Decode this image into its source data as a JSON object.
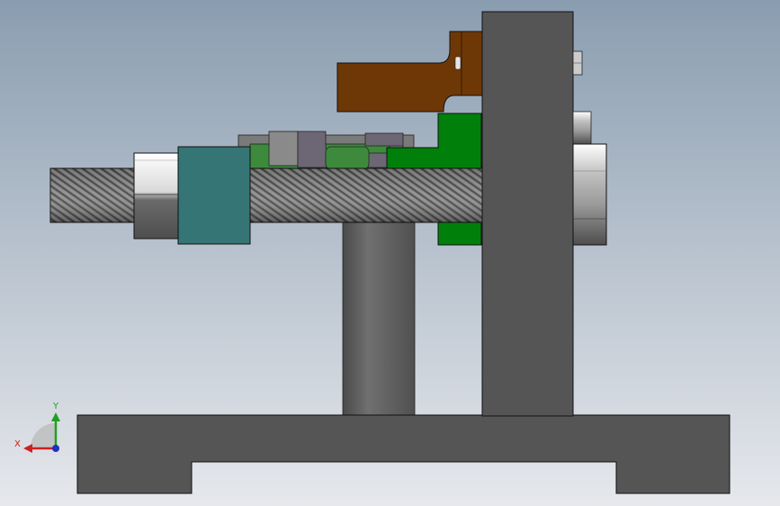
{
  "viewport": {
    "background_top": "#8a9db0",
    "background_bottom": "#e6e8ec"
  },
  "colors": {
    "base": "#555555",
    "column": "#6a6a6a",
    "plate": "#555555",
    "rod_dark": "#505050",
    "rod_light": "#8a8a8a",
    "nut_top": "#ffffff",
    "nut_bottom": "#5a5a5a",
    "block_teal": "#357575",
    "bracket_green": "#00800a",
    "plate_green": "#3d8a3d",
    "brown_arm": "#6e3806",
    "clamp_gray": "#777777",
    "clamp_mauve": "#6d6675",
    "edge": "#111111"
  },
  "triad": {
    "x_label": "X",
    "y_label": "Y",
    "x_color": "#cc2020",
    "y_color": "#20a020",
    "z_color": "#2030c0"
  }
}
